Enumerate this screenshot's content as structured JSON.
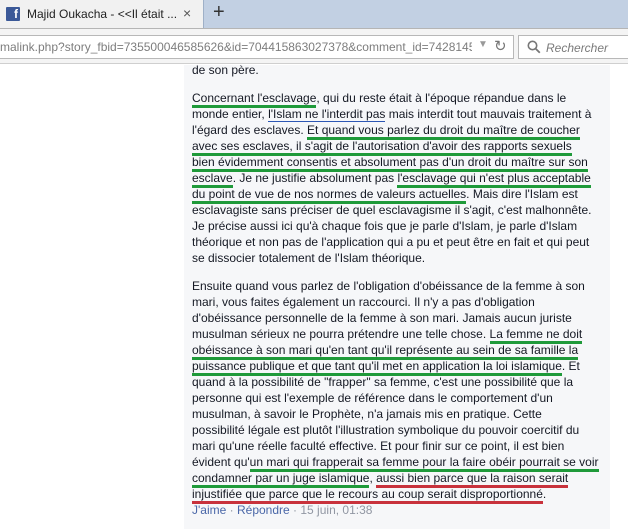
{
  "browser": {
    "tab_title": "Majid Oukacha - <<Il était ...",
    "tab_close": "×",
    "new_tab": "+",
    "url": "malink.php?story_fbid=735500046585626&id=704415863027378&comment_id=742814545",
    "search_placeholder": "Rechercher"
  },
  "comment": {
    "p0": [
      "de son père."
    ],
    "p1": [
      [
        {
          "t": "Concernant l'esclavage",
          "u": "green"
        },
        {
          "t": ", qui du reste était à l'époque répandue dans le"
        }
      ],
      [
        {
          "t": "monde entier, "
        },
        {
          "t": "l'Islam ne l'interdit pas",
          "u": "blue"
        },
        {
          "t": " mais interdit tout mauvais traitement à"
        }
      ],
      [
        {
          "t": "l'égard des esclaves. "
        },
        {
          "t": "Et quand vous parlez du droit du maître de coucher",
          "u": "green"
        }
      ],
      [
        {
          "t": "avec ses esclaves, il s'agit de l'autorisation d'avoir des rapports sexuels",
          "u": "green"
        }
      ],
      [
        {
          "t": "bien évidemment consentis et absolument pas d'un droit du maître sur son",
          "u": "green"
        }
      ],
      [
        {
          "t": "esclave",
          "u": "green"
        },
        {
          "t": ". Je ne justifie absolument pas "
        },
        {
          "t": "l'esclavage qui n'est plus acceptable",
          "u": "green"
        }
      ],
      [
        {
          "t": "du point de vue de nos normes de valeurs actuelles",
          "u": "green"
        },
        {
          "t": ". Mais dire l'Islam est"
        }
      ],
      [
        {
          "t": "esclavagiste sans préciser de quel esclavagisme il s'agit, c'est malhonnête."
        }
      ],
      [
        {
          "t": "Je précise aussi ici qu'à chaque fois que je parle d'Islam, je parle d'Islam"
        }
      ],
      [
        {
          "t": "théorique et non pas de l'application qui a pu et peut être en fait et qui peut"
        }
      ],
      [
        {
          "t": "se dissocier totalement de l'Islam théorique."
        }
      ]
    ],
    "p2": [
      [
        {
          "t": "Ensuite quand vous parlez de l'obligation d'obéissance de la femme à son"
        }
      ],
      [
        {
          "t": "mari, vous faites également un raccourci. Il n'y a pas d'obligation"
        }
      ],
      [
        {
          "t": "d'obéissance personnelle de la femme à son mari. Jamais aucun juriste"
        }
      ],
      [
        {
          "t": "musulman sérieux ne pourra prétendre une telle chose. "
        },
        {
          "t": "La femme ne doit",
          "u": "green"
        }
      ],
      [
        {
          "t": "obéissance à son mari qu'en tant qu'il représente au sein de sa famille la",
          "u": "green"
        }
      ],
      [
        {
          "t": "puissance publique et que tant qu'il met en application la loi islamique",
          "u": "green"
        },
        {
          "t": ". Et"
        }
      ],
      [
        {
          "t": "quand à la possibilité de \"frapper\" sa femme, c'est une possibilité que la"
        }
      ],
      [
        {
          "t": "personne qui est l'exemple de référence dans le comportement d'un"
        }
      ],
      [
        {
          "t": "musulman, à savoir le Prophète, n'a jamais mis en pratique. Cette"
        }
      ],
      [
        {
          "t": "possibilité légale est plutôt l'illustration symbolique du pouvoir coercitif du"
        }
      ],
      [
        {
          "t": "mari qu'une réelle faculté effective. Et pour finir sur ce point, il est bien"
        }
      ],
      [
        {
          "t": "évident qu'"
        },
        {
          "t": "un mari qui frapperait sa femme pour la faire obéir pourrait se voir",
          "u": "green"
        }
      ],
      [
        {
          "t": "condamner par un juge islamique",
          "u": "green"
        },
        {
          "t": ", "
        },
        {
          "t": "aussi bien parce que la raison serait",
          "u": "red"
        }
      ],
      [
        {
          "t": "injustifiée que parce que le recours au coup serait disproportionné",
          "u": "red"
        },
        {
          "t": "."
        }
      ]
    ],
    "actions": {
      "like": "J'aime",
      "sep": " · ",
      "reply": "Répondre",
      "timestamp": "15 juin, 01:38"
    }
  }
}
